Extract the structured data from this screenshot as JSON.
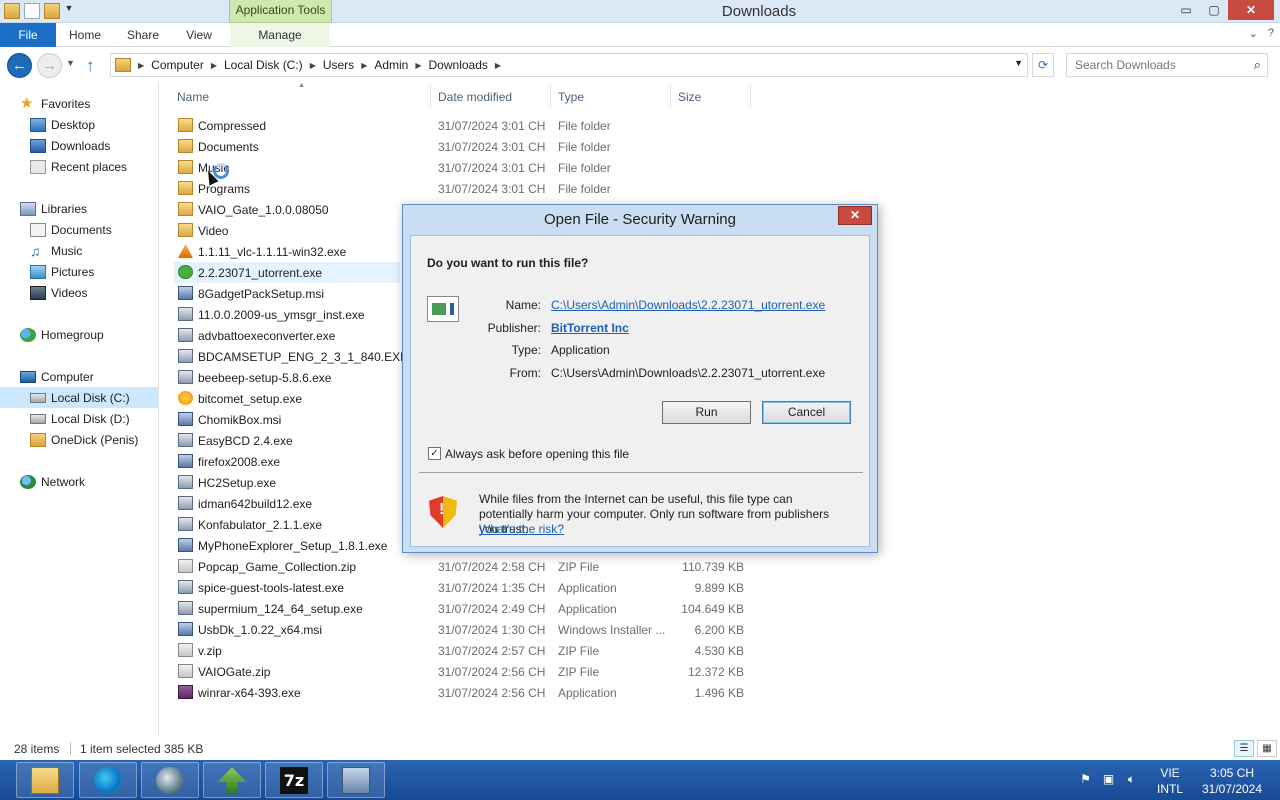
{
  "window": {
    "title": "Downloads",
    "contextual_tab": "Application Tools",
    "controls": {
      "minimize": "▭",
      "maximize": "▢",
      "close": "✕"
    }
  },
  "ribbon": {
    "tabs": [
      "File",
      "Home",
      "Share",
      "View",
      "Manage"
    ]
  },
  "address": {
    "crumbs": [
      "Computer",
      "Local Disk (C:)",
      "Users",
      "Admin",
      "Downloads"
    ],
    "search_placeholder": "Search Downloads"
  },
  "nav": {
    "favorites": "Favorites",
    "fav_items": [
      "Desktop",
      "Downloads",
      "Recent places"
    ],
    "libraries": "Libraries",
    "lib_items": [
      "Documents",
      "Music",
      "Pictures",
      "Videos"
    ],
    "homegroup": "Homegroup",
    "computer": "Computer",
    "comp_items": [
      "Local Disk (C:)",
      "Local Disk (D:)",
      "OneDick (Penis)"
    ],
    "network": "Network"
  },
  "columns": {
    "name": "Name",
    "date": "Date modified",
    "type": "Type",
    "size": "Size"
  },
  "files": [
    {
      "name": "Compressed",
      "date": "31/07/2024 3:01 CH",
      "type": "File folder",
      "size": "",
      "icon": "folder"
    },
    {
      "name": "Documents",
      "date": "31/07/2024 3:01 CH",
      "type": "File folder",
      "size": "",
      "icon": "folder"
    },
    {
      "name": "Music",
      "date": "31/07/2024 3:01 CH",
      "type": "File folder",
      "size": "",
      "icon": "folder"
    },
    {
      "name": "Programs",
      "date": "31/07/2024 3:01 CH",
      "type": "File folder",
      "size": "",
      "icon": "folder"
    },
    {
      "name": "VAIO_Gate_1.0.0.08050",
      "date": "",
      "type": "",
      "size": "",
      "icon": "folder"
    },
    {
      "name": "Video",
      "date": "",
      "type": "",
      "size": "",
      "icon": "folder"
    },
    {
      "name": "1.1.11_vlc-1.1.11-win32.exe",
      "date": "",
      "type": "",
      "size": "",
      "icon": "vlc"
    },
    {
      "name": "2.2.23071_utorrent.exe",
      "date": "",
      "type": "",
      "size": "",
      "icon": "utorrent",
      "selected": true
    },
    {
      "name": "8GadgetPackSetup.msi",
      "date": "",
      "type": "",
      "size": "",
      "icon": "setup"
    },
    {
      "name": "11.0.0.2009-us_ymsgr_inst.exe",
      "date": "",
      "type": "",
      "size": "",
      "icon": "app"
    },
    {
      "name": "advbattoexeconverter.exe",
      "date": "",
      "type": "",
      "size": "",
      "icon": "app"
    },
    {
      "name": "BDCAMSETUP_ENG_2_3_1_840.EXE",
      "date": "",
      "type": "",
      "size": "",
      "icon": "app"
    },
    {
      "name": "beebeep-setup-5.8.6.exe",
      "date": "",
      "type": "",
      "size": "",
      "icon": "app"
    },
    {
      "name": "bitcomet_setup.exe",
      "date": "",
      "type": "",
      "size": "",
      "icon": "bitcomet"
    },
    {
      "name": "ChomikBox.msi",
      "date": "",
      "type": "",
      "size": "",
      "icon": "setup"
    },
    {
      "name": "EasyBCD 2.4.exe",
      "date": "",
      "type": "",
      "size": "",
      "icon": "app"
    },
    {
      "name": "firefox2008.exe",
      "date": "",
      "type": "",
      "size": "",
      "icon": "setup"
    },
    {
      "name": "HC2Setup.exe",
      "date": "",
      "type": "",
      "size": "",
      "icon": "app"
    },
    {
      "name": "idman642build12.exe",
      "date": "",
      "type": "",
      "size": "",
      "icon": "app"
    },
    {
      "name": "Konfabulator_2.1.1.exe",
      "date": "",
      "type": "",
      "size": "",
      "icon": "app"
    },
    {
      "name": "MyPhoneExplorer_Setup_1.8.1.exe",
      "date": "",
      "type": "",
      "size": "",
      "icon": "setup"
    },
    {
      "name": "Popcap_Game_Collection.zip",
      "date": "31/07/2024 2:58 CH",
      "type": "ZIP File",
      "size": "110.739 KB",
      "icon": "zip"
    },
    {
      "name": "spice-guest-tools-latest.exe",
      "date": "31/07/2024 1:35 CH",
      "type": "Application",
      "size": "9.899 KB",
      "icon": "app"
    },
    {
      "name": "supermium_124_64_setup.exe",
      "date": "31/07/2024 2:49 CH",
      "type": "Application",
      "size": "104.649 KB",
      "icon": "app"
    },
    {
      "name": "UsbDk_1.0.22_x64.msi",
      "date": "31/07/2024 1:30 CH",
      "type": "Windows Installer ...",
      "size": "6.200 KB",
      "icon": "setup"
    },
    {
      "name": "v.zip",
      "date": "31/07/2024 2:57 CH",
      "type": "ZIP File",
      "size": "4.530 KB",
      "icon": "zip"
    },
    {
      "name": "VAIOGate.zip",
      "date": "31/07/2024 2:56 CH",
      "type": "ZIP File",
      "size": "12.372 KB",
      "icon": "zip"
    },
    {
      "name": "winrar-x64-393.exe",
      "date": "31/07/2024 2:56 CH",
      "type": "Application",
      "size": "1.496 KB",
      "icon": "rar"
    }
  ],
  "status": {
    "count": "28 items",
    "selected": "1 item selected  385 KB"
  },
  "dialog": {
    "title": "Open File - Security Warning",
    "close": "✕",
    "question": "Do you want to run this file?",
    "name_label": "Name:",
    "name_value": "C:\\Users\\Admin\\Downloads\\2.2.23071_utorrent.exe",
    "publisher_label": "Publisher:",
    "publisher_value": "BitTorrent Inc",
    "type_label": "Type:",
    "type_value": "Application",
    "from_label": "From:",
    "from_value": "C:\\Users\\Admin\\Downloads\\2.2.23071_utorrent.exe",
    "run": "Run",
    "cancel": "Cancel",
    "checkbox_label": "Always ask before opening this file",
    "checkbox_checked": true,
    "warning": "While files from the Internet can be useful, this file type can potentially harm your computer. Only run software from publishers you trust.",
    "risk_link": "What's the risk?"
  },
  "taskbar": {
    "lang_top": "VIE",
    "lang_bottom": "INTL",
    "time": "3:05 CH",
    "date": "31/07/2024",
    "seven_zip": "7z"
  }
}
